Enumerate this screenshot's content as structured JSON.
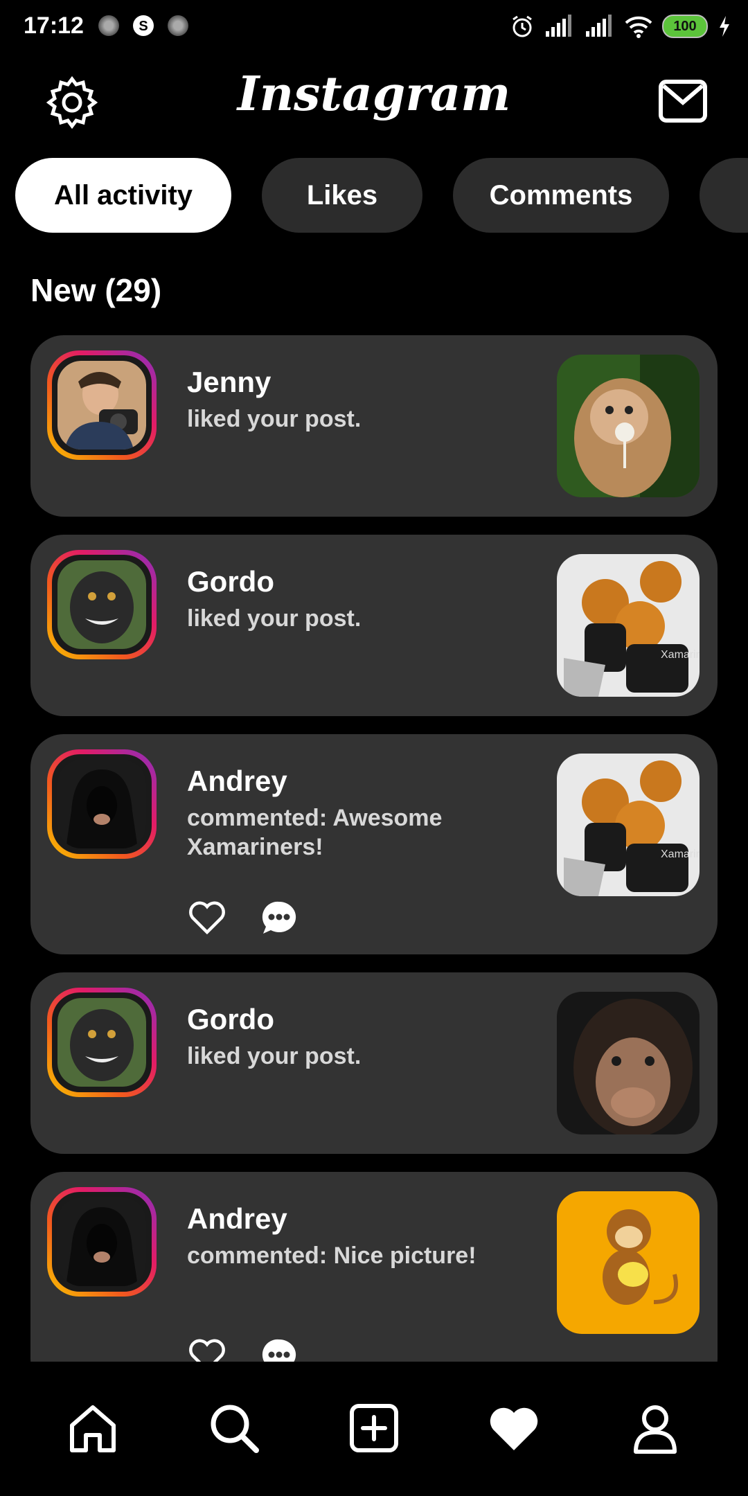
{
  "status_bar": {
    "time": "17:12",
    "battery": "100"
  },
  "header": {
    "title": "Instagram"
  },
  "filters": [
    "All activity",
    "Likes",
    "Comments"
  ],
  "section": {
    "title": "New (29)"
  },
  "activities": [
    {
      "name": "Jenny",
      "text": "liked your post."
    },
    {
      "name": "Gordo",
      "text": "liked your post."
    },
    {
      "name": "Andrey",
      "text": "commented: Awesome Xamariners!"
    },
    {
      "name": "Gordo",
      "text": "liked your post."
    },
    {
      "name": "Andrey",
      "text": "commented: Nice picture!"
    }
  ],
  "thumb_labels": {
    "xamarin": "Xamarin"
  },
  "colors": {
    "background": "#000000",
    "card": "#333333",
    "chip": "#2c2c2c",
    "battery": "#5cc43b"
  },
  "icons": [
    "settings-gear-icon",
    "mail-icon",
    "heart-icon",
    "comment-icon",
    "home-icon",
    "search-icon",
    "add-post-icon",
    "heart-filled-icon",
    "profile-icon"
  ]
}
